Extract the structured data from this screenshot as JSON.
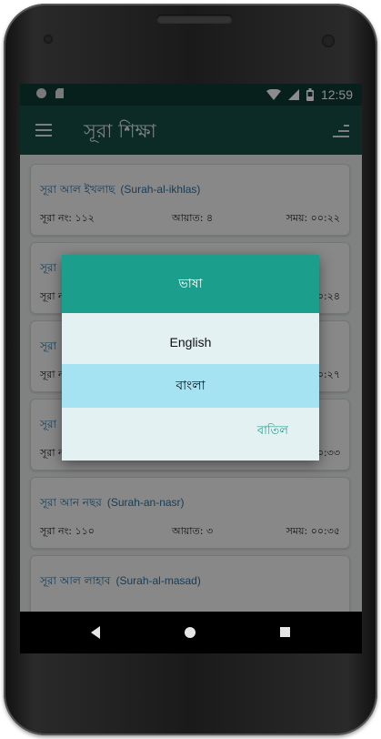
{
  "status_bar": {
    "time": "12:59"
  },
  "app_bar": {
    "title": "সূরা শিক্ষা"
  },
  "cards": [
    {
      "name": "সূরা আল ইখলাছ",
      "translit": "(Surah-al-ikhlas)",
      "num": "সূরা নং: ১১২",
      "ayat": "আয়াত: ৪",
      "time": "সময়: ০০:২২"
    },
    {
      "name": "সূরা",
      "translit": "",
      "num": "সূরা নং",
      "ayat": "",
      "time": "০০:২৪"
    },
    {
      "name": "সূরা",
      "translit": "",
      "num": "সূরা নং",
      "ayat": "",
      "time": "০০:২৭"
    },
    {
      "name": "সূরা",
      "translit": "",
      "num": "সূরা নং",
      "ayat": "",
      "time": "০০:৩৩"
    },
    {
      "name": "সূরা আন নছর",
      "translit": "(Surah-an-nasr)",
      "num": "সূরা নং: ১১০",
      "ayat": "আয়াত: ৩",
      "time": "সময়: ০০:৩৫"
    },
    {
      "name": "সূরা আল লাহাব",
      "translit": "(Surah-al-masad)",
      "num": "",
      "ayat": "",
      "time": ""
    }
  ],
  "dialog": {
    "title": "ভাষা",
    "option_english": "English",
    "option_bangla": "বাংলা",
    "cancel": "বাতিল"
  },
  "colors": {
    "status_bar": "#0d3b34",
    "app_bar": "#164f47",
    "dialog_header": "#1b9e8b",
    "selected_option": "#a6e3f2",
    "cancel_text": "#2a9e8c"
  }
}
